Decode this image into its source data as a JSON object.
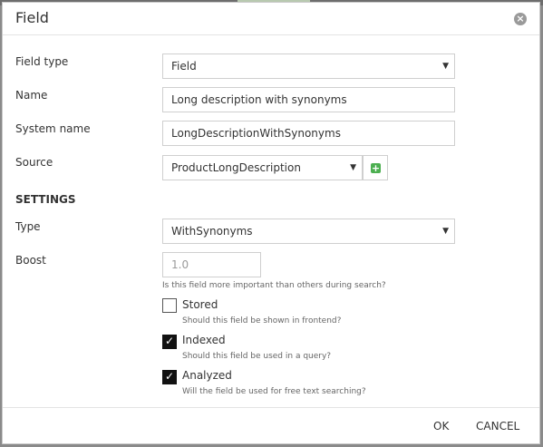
{
  "dialog": {
    "title": "Field"
  },
  "form": {
    "field_type": {
      "label": "Field type",
      "value": "Field"
    },
    "name": {
      "label": "Name",
      "value": "Long description with synonyms"
    },
    "system_name": {
      "label": "System name",
      "value": "LongDescriptionWithSynonyms"
    },
    "source": {
      "label": "Source",
      "value": "ProductLongDescription"
    }
  },
  "settings": {
    "heading": "SETTINGS",
    "type": {
      "label": "Type",
      "value": "WithSynonyms"
    },
    "boost": {
      "label": "Boost",
      "value": "1.0",
      "hint": "Is this field more important than others during search?"
    },
    "stored": {
      "label": "Stored",
      "checked": false,
      "hint": "Should this field be shown in frontend?"
    },
    "indexed": {
      "label": "Indexed",
      "checked": true,
      "hint": "Should this field be used in a query?"
    },
    "analyzed": {
      "label": "Analyzed",
      "checked": true,
      "hint": "Will the field be used for free text searching?"
    }
  },
  "footer": {
    "ok_label": "OK",
    "cancel_label": "CANCEL"
  },
  "icons": {
    "close": "close-icon",
    "add": "plus-icon",
    "caret": "chevron-down-icon",
    "check": "checkmark-icon"
  },
  "colors": {
    "add_accent": "#4caf50",
    "checked_box": "#111111"
  }
}
